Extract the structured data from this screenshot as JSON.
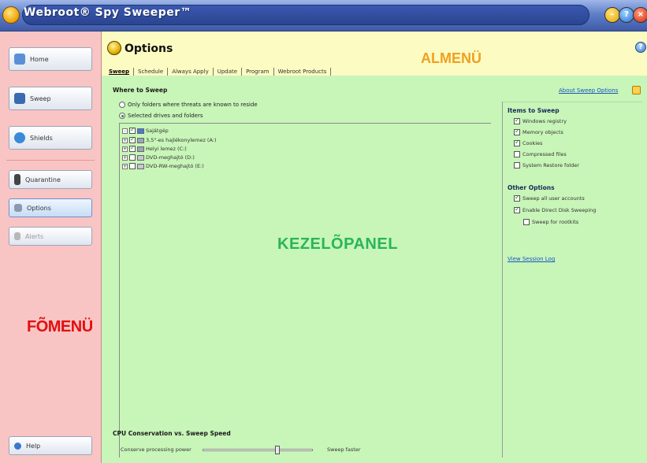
{
  "window": {
    "title": "Webroot® Spy Sweeper™"
  },
  "main_menu": {
    "label": "FÕMENÜ",
    "items": [
      {
        "label": "Home",
        "icon": "home-icon"
      },
      {
        "label": "Sweep",
        "icon": "sweep-icon"
      },
      {
        "label": "Shields",
        "icon": "shield-icon"
      },
      {
        "label": "Quarantine",
        "icon": "quarantine-icon"
      },
      {
        "label": "Options",
        "icon": "options-icon",
        "active": true
      },
      {
        "label": "Alerts",
        "icon": "alerts-icon",
        "disabled": true
      }
    ],
    "help_label": "Help"
  },
  "header": {
    "title": "Options",
    "submenu_label": "ALMENÜ",
    "tabs": [
      "Sweep",
      "Schedule",
      "Always Apply",
      "Update",
      "Program",
      "Webroot Products"
    ],
    "active_tab": "Sweep"
  },
  "panel": {
    "label": "KEZELÕPANEL",
    "where_to_sweep": {
      "title": "Where to Sweep",
      "option_known": "Only folders where threats are known to reside",
      "option_selected": "Selected drives and folders",
      "tree": [
        {
          "label": "Sajátgép",
          "checked": true
        },
        {
          "label": "3,5\"-es hajlékonylemez (A:)",
          "checked": true
        },
        {
          "label": "Helyi lemez (C:)",
          "checked": true
        },
        {
          "label": "DVD-meghajtó (D:)",
          "checked": false
        },
        {
          "label": "DVD-RW-meghajtó (E:)",
          "checked": false
        }
      ]
    },
    "about_link": "About Sweep Options",
    "items_to_sweep": {
      "title": "Items to Sweep",
      "items": [
        {
          "label": "Windows registry",
          "checked": true
        },
        {
          "label": "Memory objects",
          "checked": true
        },
        {
          "label": "Cookies",
          "checked": true
        },
        {
          "label": "Compressed files",
          "checked": false
        },
        {
          "label": "System Restore folder",
          "checked": false
        }
      ]
    },
    "other_options": {
      "title": "Other Options",
      "items": [
        {
          "label": "Sweep all user accounts",
          "checked": true
        },
        {
          "label": "Enable Direct Disk Sweeping",
          "checked": true
        },
        {
          "label": "Sweep for rootkits",
          "checked": false
        }
      ]
    },
    "session_log_link": "View Session Log",
    "cpu": {
      "title": "CPU Conservation vs. Sweep Speed",
      "left_label": "Conserve processing power",
      "right_label": "Sweep faster",
      "value": 0.68
    }
  },
  "colors": {
    "sidebar_bg": "#f9c4c4",
    "header_bg": "#fbfbc2",
    "content_bg": "#c8f5b8",
    "main_menu_label": "#e01010",
    "submenu_label": "#f0a020",
    "panel_label": "#29b559"
  }
}
